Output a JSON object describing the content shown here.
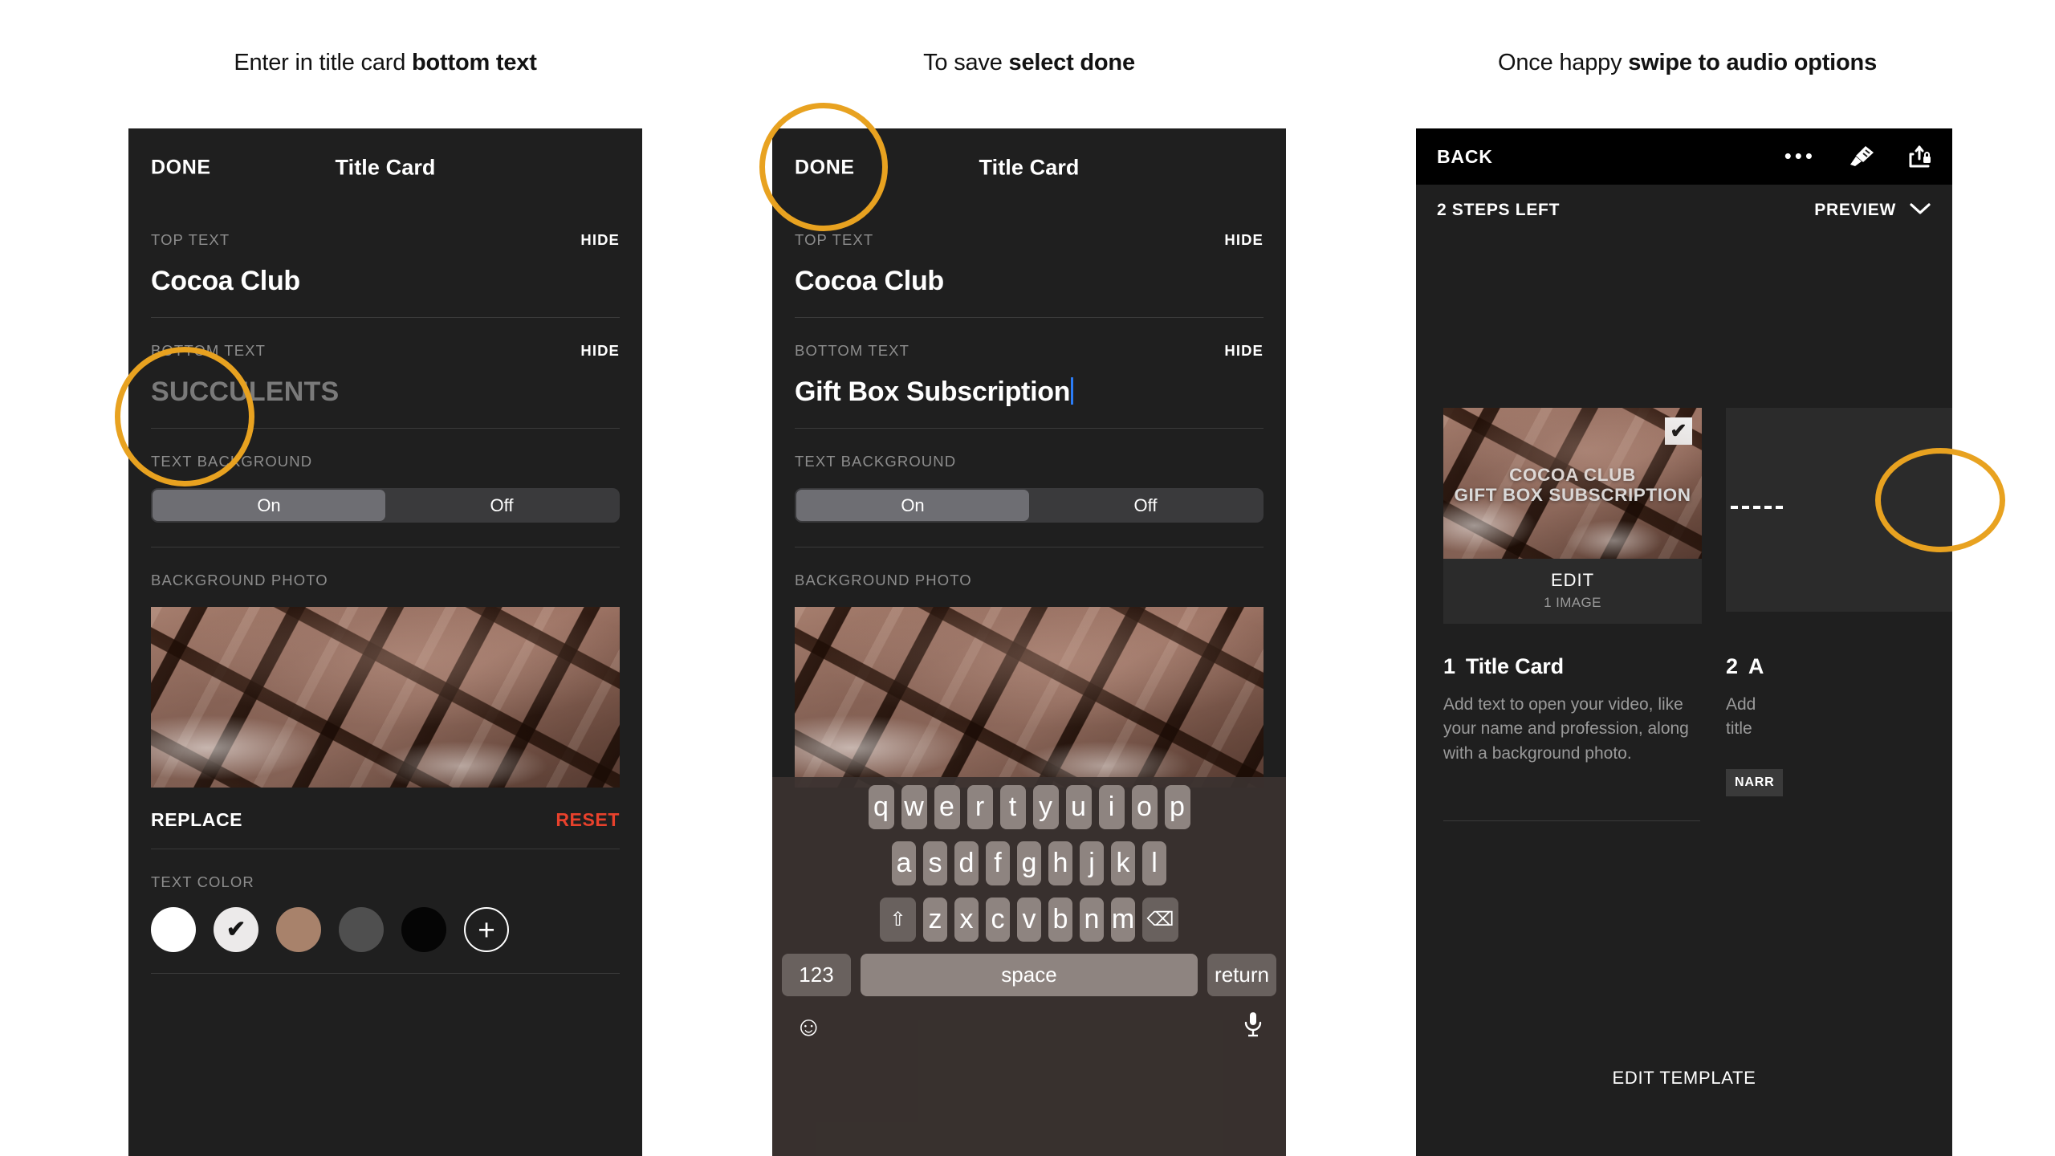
{
  "captions": [
    {
      "plain": "Enter in title card ",
      "bold": "bottom text"
    },
    {
      "plain": "To save ",
      "bold": "select done"
    },
    {
      "plain": "Once happy ",
      "bold": "swipe to audio options"
    }
  ],
  "panel1": {
    "nav": {
      "done": "DONE",
      "title": "Title Card"
    },
    "top_text": {
      "label": "TOP TEXT",
      "hide": "HIDE",
      "value": "Cocoa Club"
    },
    "bottom_text": {
      "label": "BOTTOM TEXT",
      "hide": "HIDE",
      "placeholder": "SUCCULENTS"
    },
    "text_background": {
      "label": "TEXT BACKGROUND",
      "on": "On",
      "off": "Off",
      "selected": "On"
    },
    "background_photo": {
      "label": "BACKGROUND PHOTO",
      "replace": "REPLACE",
      "reset": "RESET"
    },
    "text_color": {
      "label": "TEXT COLOR",
      "swatches": [
        {
          "name": "white",
          "hex": "#ffffff",
          "selected": false
        },
        {
          "name": "off-white",
          "hex": "#eceaea",
          "selected": true,
          "tick": "✔"
        },
        {
          "name": "tan",
          "hex": "#a8826b",
          "selected": false
        },
        {
          "name": "dark-gray",
          "hex": "#4f4f4f",
          "selected": false
        },
        {
          "name": "black",
          "hex": "#050505",
          "selected": false
        }
      ],
      "add_label": "+"
    }
  },
  "panel2": {
    "nav": {
      "done": "DONE",
      "title": "Title Card"
    },
    "top_text": {
      "label": "TOP TEXT",
      "hide": "HIDE",
      "value": "Cocoa Club"
    },
    "bottom_text": {
      "label": "BOTTOM TEXT",
      "hide": "HIDE",
      "value": "Gift Box Subscription"
    },
    "text_background": {
      "label": "TEXT BACKGROUND",
      "on": "On",
      "off": "Off",
      "selected": "On"
    },
    "background_photo": {
      "label": "BACKGROUND PHOTO"
    },
    "keyboard": {
      "row1": [
        "q",
        "w",
        "e",
        "r",
        "t",
        "y",
        "u",
        "i",
        "o",
        "p"
      ],
      "row2": [
        "a",
        "s",
        "d",
        "f",
        "g",
        "h",
        "j",
        "k",
        "l"
      ],
      "row3": [
        "z",
        "x",
        "c",
        "v",
        "b",
        "n",
        "m"
      ],
      "shift": "⇧",
      "backspace": "⌫",
      "numbers": "123",
      "space": "space",
      "return": "return",
      "emoji": "☺",
      "mic": "🎙"
    }
  },
  "panel3": {
    "nav": {
      "back": "BACK",
      "more": "•••",
      "brush": "paintbrush",
      "share": "share-lock"
    },
    "subbar": {
      "steps": "2 STEPS LEFT",
      "preview": "PREVIEW",
      "chevron": "∨"
    },
    "card": {
      "overlay_line1": "COCOA CLUB",
      "overlay_line2": "GIFT BOX SUBSCRIPTION",
      "check": "✔",
      "edit": "EDIT",
      "images": "1 IMAGE"
    },
    "steps": [
      {
        "number": "1",
        "title": "Title Card",
        "description": "Add text to open your video, like your name and profession, along with a background photo."
      },
      {
        "number": "2",
        "title": "A",
        "description_line1": "Add",
        "description_line2": "title",
        "badge": "NARR"
      }
    ],
    "edit_template": "EDIT TEMPLATE"
  },
  "annotation_color": "#e8a220"
}
